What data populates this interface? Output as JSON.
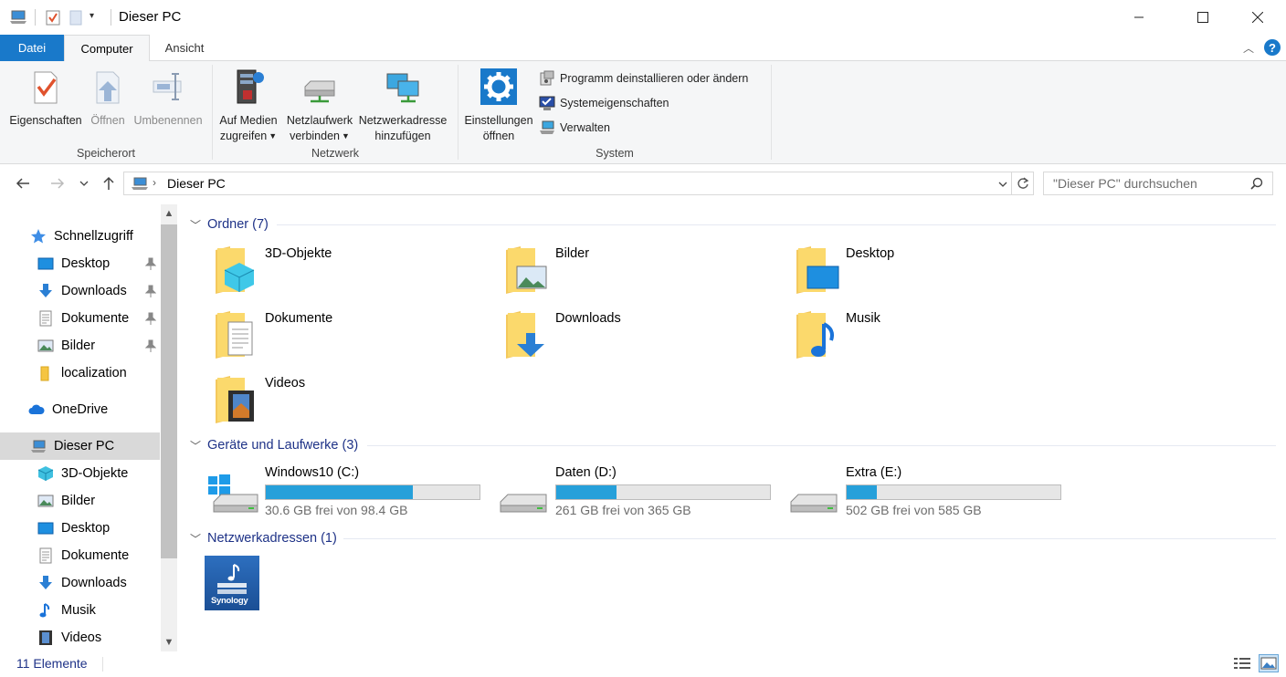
{
  "window": {
    "title": "Dieser PC"
  },
  "ribbon_tabs": {
    "datei": "Datei",
    "computer": "Computer",
    "ansicht": "Ansicht"
  },
  "ribbon": {
    "speicherort": {
      "label": "Speicherort",
      "eigenschaften": "Eigenschaften",
      "oeffnen": "Öffnen",
      "umbenennen": "Umbenennen"
    },
    "netzwerk": {
      "label": "Netzwerk",
      "medien_l1": "Auf Medien",
      "medien_l2": "zugreifen",
      "netzlaufwerk_l1": "Netzlaufwerk",
      "netzlaufwerk_l2": "verbinden",
      "netzwerkadresse_l1": "Netzwerkadresse",
      "netzwerkadresse_l2": "hinzufügen"
    },
    "system": {
      "label": "System",
      "einstellungen_l1": "Einstellungen",
      "einstellungen_l2": "öffnen",
      "programm": "Programm deinstallieren oder ändern",
      "systemeigenschaften": "Systemeigenschaften",
      "verwalten": "Verwalten"
    }
  },
  "address": {
    "crumb": "Dieser PC",
    "search_placeholder": "\"Dieser PC\" durchsuchen"
  },
  "nav": {
    "schnellzugriff": "Schnellzugriff",
    "quick": [
      "Desktop",
      "Downloads",
      "Dokumente",
      "Bilder",
      "localization"
    ],
    "onedrive": "OneDrive",
    "dieser_pc": "Dieser PC",
    "pc_items": [
      "3D-Objekte",
      "Bilder",
      "Desktop",
      "Dokumente",
      "Downloads",
      "Musik",
      "Videos"
    ]
  },
  "groups": {
    "ordner": "Ordner (7)",
    "geraete": "Geräte und Laufwerke (3)",
    "netzwerkadressen": "Netzwerkadressen (1)"
  },
  "folders": [
    "3D-Objekte",
    "Bilder",
    "Desktop",
    "Dokumente",
    "Downloads",
    "Musik",
    "Videos"
  ],
  "drives": [
    {
      "name": "Windows10 (C:)",
      "free": "30.6 GB frei von 98.4 GB",
      "used_fraction": 0.69
    },
    {
      "name": "Daten (D:)",
      "free": "261 GB frei von 365 GB",
      "used_fraction": 0.28
    },
    {
      "name": "Extra (E:)",
      "free": "502 GB frei von 585 GB",
      "used_fraction": 0.14
    }
  ],
  "network_location": {
    "logo_text": "Synology"
  },
  "status": {
    "count": "11 Elemente"
  },
  "colors": {
    "accent": "#1979ca",
    "bar_fill": "#26a0da",
    "group_text": "#1e3287"
  }
}
